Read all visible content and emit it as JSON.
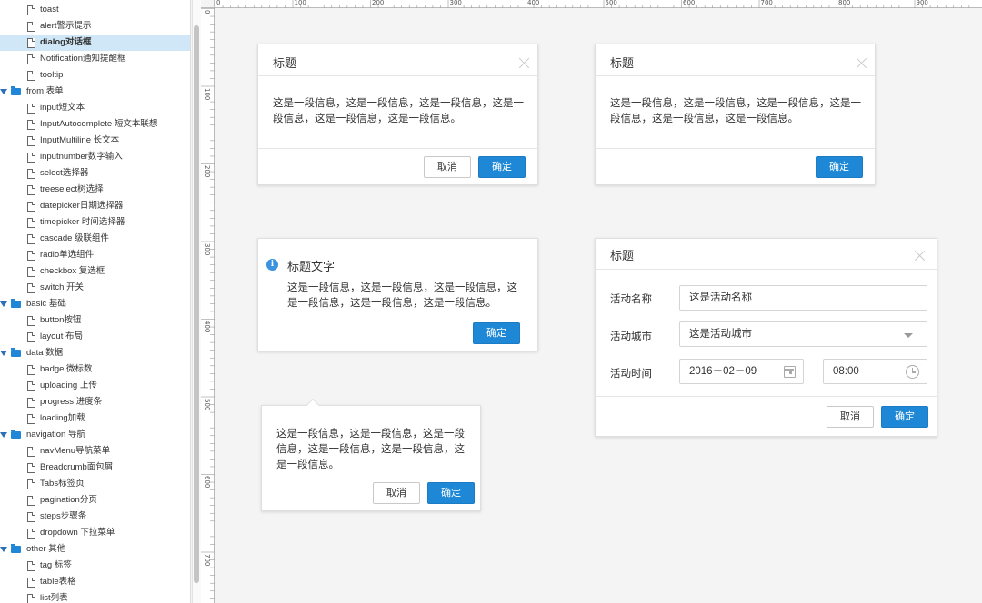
{
  "sidebar": {
    "items": [
      {
        "type": "file",
        "label": "toast"
      },
      {
        "type": "file",
        "label": "alert警示提示"
      },
      {
        "type": "file",
        "label": "dialog对话框",
        "selected": true
      },
      {
        "type": "file",
        "label": "Notification通知提醒框"
      },
      {
        "type": "file",
        "label": "tooltip"
      },
      {
        "type": "folder",
        "label": "from 表单"
      },
      {
        "type": "file",
        "label": "input短文本"
      },
      {
        "type": "file",
        "label": "InputAutocomplete 短文本联想"
      },
      {
        "type": "file",
        "label": "InputMultiline 长文本"
      },
      {
        "type": "file",
        "label": "inputnumber数字输入"
      },
      {
        "type": "file",
        "label": "select选择器"
      },
      {
        "type": "file",
        "label": "treeselect树选择"
      },
      {
        "type": "file",
        "label": "datepicker日期选择器"
      },
      {
        "type": "file",
        "label": "timepicker 时间选择器"
      },
      {
        "type": "file",
        "label": "cascade 级联组件"
      },
      {
        "type": "file",
        "label": "radio单选组件"
      },
      {
        "type": "file",
        "label": "checkbox 复选框"
      },
      {
        "type": "file",
        "label": "switch 开关"
      },
      {
        "type": "folder",
        "label": "basic 基础"
      },
      {
        "type": "file",
        "label": "button按钮"
      },
      {
        "type": "file",
        "label": "layout 布局"
      },
      {
        "type": "folder",
        "label": "data 数据"
      },
      {
        "type": "file",
        "label": "badge 微标数"
      },
      {
        "type": "file",
        "label": "uploading 上传"
      },
      {
        "type": "file",
        "label": "progress 进度条"
      },
      {
        "type": "file",
        "label": "loading加载"
      },
      {
        "type": "folder",
        "label": "navigation 导航"
      },
      {
        "type": "file",
        "label": "navMenu导航菜单"
      },
      {
        "type": "file",
        "label": "Breadcrumb面包屑"
      },
      {
        "type": "file",
        "label": "Tabs标签页"
      },
      {
        "type": "file",
        "label": "pagination分页"
      },
      {
        "type": "file",
        "label": "steps步骤条"
      },
      {
        "type": "file",
        "label": "dropdown 下拉菜单"
      },
      {
        "type": "folder",
        "label": "other 其他"
      },
      {
        "type": "file",
        "label": "tag 标签"
      },
      {
        "type": "file",
        "label": "table表格"
      },
      {
        "type": "file",
        "label": "list列表"
      }
    ]
  },
  "ruler": {
    "h_labels": [
      "0",
      "100",
      "200",
      "300",
      "400",
      "500",
      "600",
      "700",
      "800",
      "900"
    ],
    "v_labels": [
      "0",
      "100",
      "200",
      "300",
      "400",
      "500",
      "600",
      "700"
    ]
  },
  "dialog1": {
    "title": "标题",
    "body": "这是一段信息，这是一段信息，这是一段信息，这是一段信息，这是一段信息，这是一段信息。",
    "cancel": "取消",
    "ok": "确定"
  },
  "dialog2": {
    "title": "标题",
    "body": "这是一段信息，这是一段信息，这是一段信息，这是一段信息，这是一段信息，这是一段信息。",
    "ok": "确定"
  },
  "dialog3": {
    "title": "标题文字",
    "body": "这是一段信息，这是一段信息，这是一段信息，这是一段信息，这是一段信息，这是一段信息。",
    "ok": "确定"
  },
  "popconfirm": {
    "body": "这是一段信息，这是一段信息，这是一段信息，这是一段信息，这是一段信息，这是一段信息。",
    "cancel": "取消",
    "ok": "确定"
  },
  "form_dialog": {
    "title": "标题",
    "name_label": "活动名称",
    "name_value": "这是活动名称",
    "city_label": "活动城市",
    "city_value": "这是活动城市",
    "time_label": "活动时间",
    "date_value": "2016－02－09",
    "time_value": "08:00",
    "cancel": "取消",
    "ok": "确定"
  },
  "colors": {
    "primary": "#1e88d6",
    "selected_row": "#cfe7f7",
    "folder": "#1f86d8"
  }
}
